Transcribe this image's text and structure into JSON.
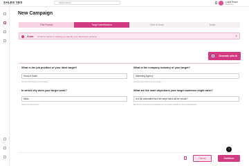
{
  "app": {
    "logo": "SALES YES",
    "logo_tagline": "close smarter, grow faster"
  },
  "header": {
    "search_placeholder": "Search content",
    "user_name": "Lucia Rossi",
    "user_role": "Marketing"
  },
  "page": {
    "title": "New Campaign"
  },
  "tabs": [
    {
      "label": "The Product",
      "state": "done"
    },
    {
      "label": "Target Identification",
      "state": "active"
    },
    {
      "label": "Tone of Voice",
      "state": "inactive"
    },
    {
      "label": "Script",
      "state": "inactive"
    }
  ],
  "guide": {
    "title": "Guide",
    "text": "AI will be trained in helping you identify your ideal buyer persona.",
    "close_icon": "close-icon"
  },
  "generate_button": {
    "label": "Generate with AI",
    "icon": "document-sparkle-icon"
  },
  "questions": [
    {
      "label": "What is the job position of your ideal target?",
      "value": "Head of Sales",
      "hint": "Add the Job Position of your target"
    },
    {
      "label": "What is the company industry of your target?",
      "value": "Marketing Agency",
      "hint": "Add the main industry of your target"
    },
    {
      "label": "In which city does your target work?",
      "value": "Milan",
      "hint": "Select the City/Country"
    },
    {
      "label": "What are the main objections your target audience might raise?",
      "value": "Is it full automated and the script used will be robotic?",
      "hint": "Identify the most common objections of your target towards to your product/service"
    }
  ],
  "footer": {
    "cancel_label": "Cancel",
    "continue_label": "Continue",
    "help_label": "?"
  },
  "colors": {
    "accent": "#d23a81",
    "accent_light": "#fbe3ee",
    "guide_bg": "#fce6f0"
  }
}
